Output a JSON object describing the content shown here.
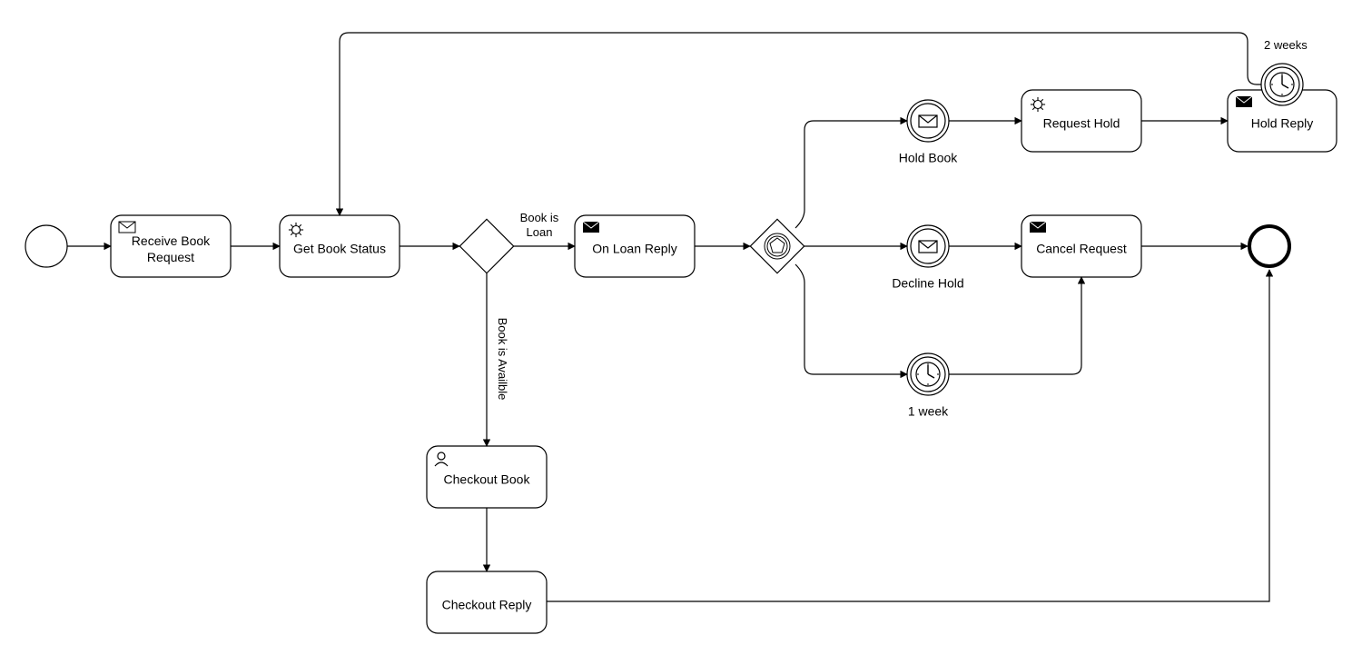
{
  "tasks": {
    "receive_book_request": "Receive Book\nRequest",
    "get_book_status": "Get Book Status",
    "on_loan_reply": "On Loan Reply",
    "checkout_book": "Checkout Book",
    "checkout_reply": "Checkout Reply",
    "request_hold": "Request Hold",
    "hold_reply": "Hold Reply",
    "cancel_request": "Cancel Request"
  },
  "events": {
    "hold_book": "Hold Book",
    "decline_hold": "Decline Hold",
    "one_week": "1 week",
    "two_weeks": "2 weeks"
  },
  "edges": {
    "book_is_loan": "Book is\nLoan",
    "book_is_available": "Book is Availble"
  }
}
